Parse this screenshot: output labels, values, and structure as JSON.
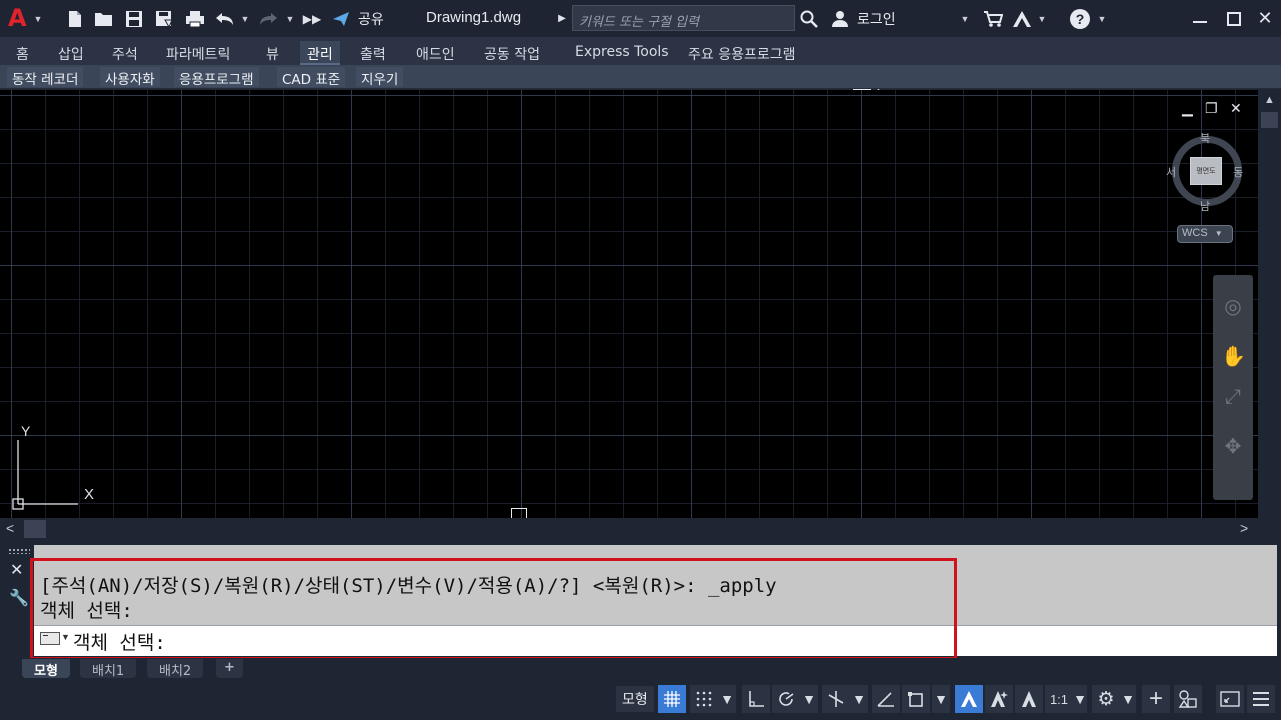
{
  "app": {
    "logo": "A",
    "document_title": "Drawing1.dwg",
    "share_label": "공유",
    "search_placeholder": "키워드 또는 구절 입력",
    "login_label": "로그인",
    "help_label": "?"
  },
  "ribbon": {
    "tabs": [
      {
        "label": "홈",
        "active": false
      },
      {
        "label": "삽입",
        "active": false
      },
      {
        "label": "주석",
        "active": false
      },
      {
        "label": "파라메트릭",
        "active": false
      },
      {
        "label": "뷰",
        "active": false
      },
      {
        "label": "관리",
        "active": true
      },
      {
        "label": "출력",
        "active": false
      },
      {
        "label": "애드인",
        "active": false
      },
      {
        "label": "공동 작업",
        "active": false
      },
      {
        "label": "Express Tools",
        "active": false
      },
      {
        "label": "주요 응용프로그램",
        "active": false
      }
    ],
    "panels": [
      "동작 레코더",
      "사용자화",
      "응용프로그램",
      "CAD 표준",
      "지우기"
    ]
  },
  "viewcube": {
    "north": "북",
    "south": "남",
    "east": "동",
    "west": "서",
    "face": "평면도",
    "wcs_label": "WCS"
  },
  "ucs": {
    "x_label": "X",
    "y_label": "Y"
  },
  "command_line": {
    "history": [
      "[주석(AN)/저장(S)/복원(R)/상태(ST)/변수(V)/적용(A)/?] <복원(R)>: _apply",
      "객체 선택:"
    ],
    "prompt": "객체 선택:"
  },
  "layout_tabs": [
    {
      "label": "모형",
      "active": true
    },
    {
      "label": "배치1",
      "active": false
    },
    {
      "label": "배치2",
      "active": false
    }
  ],
  "add_tab_label": "+",
  "statusbar": {
    "model_label": "모형",
    "scale_label": "1:1"
  },
  "colors": {
    "accent_blue": "#3a7bd5",
    "highlight_red": "#d0121c",
    "autocad_red": "#e2232b"
  }
}
